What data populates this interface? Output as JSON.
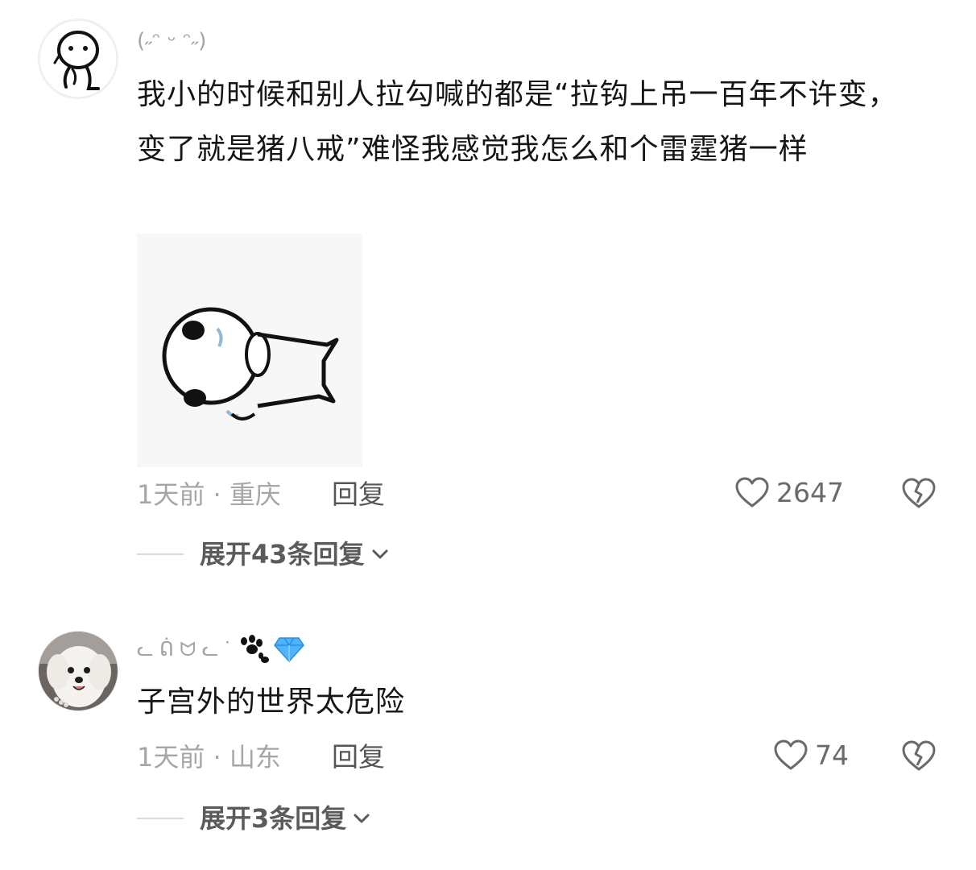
{
  "comments": [
    {
      "username": "(˶ᵔ ᵕ ᵔ˶)",
      "text": "我小的时候和别人拉勾喊的都是“拉钩上吊一百年不许变，变了就是猪八戒”难怪我感觉我怎么和个雷霆猪一样",
      "time_location": "1天前 · 重庆",
      "reply_label": "回复",
      "likes": "2647",
      "expand_label": "展开43条回复",
      "avatar_icon": "stick-figure-avatar",
      "sticker_icon": "cartoon-sticker"
    },
    {
      "username": "ᓚ ᕢ ᗢ ᓚ ᐝ",
      "text": "子宫外的世界太危险",
      "time_location": "1天前 · 山东",
      "reply_label": "回复",
      "likes": "74",
      "expand_label": "展开3条回复",
      "avatar_icon": "white-dog-avatar",
      "badge_icon": "diamond-icon"
    }
  ],
  "colors": {
    "meta_gray": "#a6a6a6",
    "text_dark": "#161616",
    "diamond_blue": "#4fb3ff"
  }
}
